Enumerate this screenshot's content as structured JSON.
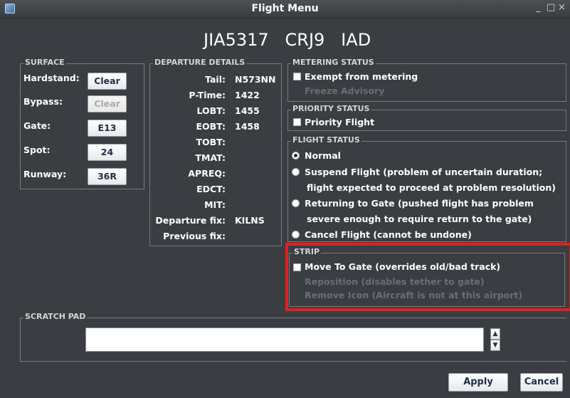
{
  "window": {
    "title": "Flight Menu",
    "min": "_",
    "max": "□",
    "close": "×"
  },
  "header": {
    "callsign": "JIA5317",
    "aircraft": "CRJ9",
    "destination": "IAD"
  },
  "surface": {
    "title": "SURFACE",
    "hardstand_label": "Hardstand:",
    "hardstand_button": "Clear",
    "bypass_label": "Bypass:",
    "bypass_button": "Clear",
    "gate_label": "Gate:",
    "gate_value": "E13",
    "spot_label": "Spot:",
    "spot_value": "24",
    "runway_label": "Runway:",
    "runway_value": "36R"
  },
  "departure": {
    "title": "DEPARTURE DETAILS",
    "rows": [
      {
        "label": "Tail:",
        "value": "N573NN"
      },
      {
        "label": "P-Time:",
        "value": "1422"
      },
      {
        "label": "LOBT:",
        "value": "1455"
      },
      {
        "label": "EOBT:",
        "value": "1458"
      },
      {
        "label": "TOBT:",
        "value": ""
      },
      {
        "label": "TMAT:",
        "value": ""
      },
      {
        "label": "APREQ:",
        "value": ""
      },
      {
        "label": "EDCT:",
        "value": ""
      },
      {
        "label": "MIT:",
        "value": ""
      },
      {
        "label": "Departure fix:",
        "value": "KILNS"
      },
      {
        "label": "Previous fix:",
        "value": ""
      }
    ]
  },
  "metering": {
    "title": "METERING STATUS",
    "exempt_label": "Exempt from metering",
    "freeze_label": "Freeze Advisory"
  },
  "priority": {
    "title": "PRIORITY STATUS",
    "priority_label": "Priority Flight"
  },
  "flight_status": {
    "title": "FLIGHT STATUS",
    "normal": "Normal",
    "suspend_line1": "Suspend Flight (problem of uncertain duration;",
    "suspend_line2": "flight expected to proceed at problem resolution)",
    "returning_line1": "Returning to Gate (pushed flight has problem",
    "returning_line2": "severe enough to require return to the gate)",
    "cancel": "Cancel Flight (cannot be undone)"
  },
  "strip": {
    "title": "STRIP",
    "move_to_gate": "Move To Gate (overrides old/bad track)",
    "reposition": "Reposition (disables tether to gate)",
    "remove_icon": "Remove Icon (Aircraft is not at this airport)"
  },
  "scratch_pad": {
    "title": "SCRATCH PAD",
    "value": ""
  },
  "actions": {
    "apply": "Apply",
    "cancel": "Cancel"
  },
  "colors": {
    "background": "#3a3d41",
    "highlight": "#e02020"
  }
}
